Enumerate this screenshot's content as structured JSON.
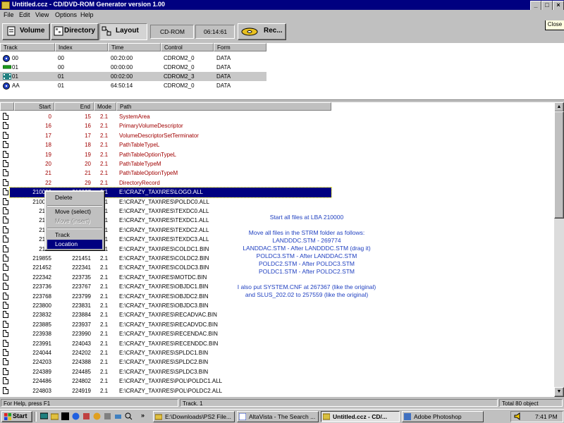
{
  "window": {
    "title": "Untitled.ccz - CD/DVD-ROM Generator version 1.00",
    "controls": [
      "_",
      "□",
      "×"
    ]
  },
  "tooltip": "Close",
  "menu": [
    "File",
    "Edit",
    "View",
    "Options",
    "Help"
  ],
  "toolbar": {
    "volume": "Volume",
    "directory": "Directory",
    "layout": "Layout",
    "device": "CD-ROM",
    "time": "06:14:61",
    "record": "Rec..."
  },
  "tracks": {
    "headers": [
      "Track",
      "Index",
      "Time",
      "Control",
      "Form"
    ],
    "rows": [
      {
        "track": "00",
        "index": "00",
        "time": "00:20:00",
        "control": "CDROM2_0",
        "form": "DATA",
        "icon": "disc-icon"
      },
      {
        "track": "01",
        "index": "00",
        "time": "00:00:00",
        "control": "CDROM2_0",
        "form": "DATA",
        "icon": "green-bar-icon"
      },
      {
        "track": "01",
        "index": "01",
        "time": "00:02:00",
        "control": "CDROM2_3",
        "form": "DATA",
        "icon": "film-icon",
        "selected": true
      },
      {
        "track": "AA",
        "index": "01",
        "time": "64:50:14",
        "control": "CDROM2_0",
        "form": "DATA",
        "icon": "disc-icon"
      }
    ]
  },
  "files": {
    "headers": [
      "Start",
      "End",
      "Mode",
      "Path"
    ],
    "rows": [
      {
        "start": "0",
        "end": "15",
        "mode": "2.1",
        "path": "SystemArea",
        "red": true
      },
      {
        "start": "16",
        "end": "16",
        "mode": "2.1",
        "path": "PrimaryVolumeDescriptor",
        "red": true
      },
      {
        "start": "17",
        "end": "17",
        "mode": "2.1",
        "path": "VolumeDescriptorSetTerminator",
        "red": true
      },
      {
        "start": "18",
        "end": "18",
        "mode": "2.1",
        "path": "PathTableTypeL",
        "red": true
      },
      {
        "start": "19",
        "end": "19",
        "mode": "2.1",
        "path": "PathTableOptionTypeL",
        "red": true
      },
      {
        "start": "20",
        "end": "20",
        "mode": "2.1",
        "path": "PathTableTypeM",
        "red": true
      },
      {
        "start": "21",
        "end": "21",
        "mode": "2.1",
        "path": "PathTableOptionTypeM",
        "red": true
      },
      {
        "start": "22",
        "end": "29",
        "mode": "2.1",
        "path": "DirectoryRecord",
        "red": true
      },
      {
        "start": "210000",
        "end": "210037",
        "mode": "2.1",
        "path": "E:\\CRAZY_TAXI\\RES\\LOGO.ALL",
        "selected": true
      },
      {
        "start": "210038",
        "end": "",
        "mode": "2.1",
        "path": "E:\\CRAZY_TAXI\\RES\\POLDC0.ALL"
      },
      {
        "start": "2131",
        "end": "",
        "mode": "2.1",
        "path": "E:\\CRAZY_TAXI\\RES\\TEXDC0.ALL"
      },
      {
        "start": "2145",
        "end": "",
        "mode": "2.1",
        "path": "E:\\CRAZY_TAXI\\RES\\TEXDC1.ALL"
      },
      {
        "start": "2157",
        "end": "",
        "mode": "2.1",
        "path": "E:\\CRAZY_TAXI\\RES\\TEXDC2.ALL"
      },
      {
        "start": "2170",
        "end": "",
        "mode": "2.1",
        "path": "E:\\CRAZY_TAXI\\RES\\TEXDC3.ALL"
      },
      {
        "start": "2184",
        "end": "",
        "mode": "2.1",
        "path": "E:\\CRAZY_TAXI\\RES\\COLDC1.BIN"
      },
      {
        "start": "219855",
        "end": "221451",
        "mode": "2.1",
        "path": "E:\\CRAZY_TAXI\\RES\\COLDC2.BIN"
      },
      {
        "start": "221452",
        "end": "222341",
        "mode": "2.1",
        "path": "E:\\CRAZY_TAXI\\RES\\COLDC3.BIN"
      },
      {
        "start": "222342",
        "end": "223735",
        "mode": "2.1",
        "path": "E:\\CRAZY_TAXI\\RES\\MOTDC.BIN"
      },
      {
        "start": "223736",
        "end": "223767",
        "mode": "2.1",
        "path": "E:\\CRAZY_TAXI\\RES\\OBJDC1.BIN"
      },
      {
        "start": "223768",
        "end": "223799",
        "mode": "2.1",
        "path": "E:\\CRAZY_TAXI\\RES\\OBJDC2.BIN"
      },
      {
        "start": "223800",
        "end": "223831",
        "mode": "2.1",
        "path": "E:\\CRAZY_TAXI\\RES\\OBJDC3.BIN"
      },
      {
        "start": "223832",
        "end": "223884",
        "mode": "2.1",
        "path": "E:\\CRAZY_TAXI\\RES\\RECADVAC.BIN"
      },
      {
        "start": "223885",
        "end": "223937",
        "mode": "2.1",
        "path": "E:\\CRAZY_TAXI\\RES\\RECADVDC.BIN"
      },
      {
        "start": "223938",
        "end": "223990",
        "mode": "2.1",
        "path": "E:\\CRAZY_TAXI\\RES\\RECENDAC.BIN"
      },
      {
        "start": "223991",
        "end": "224043",
        "mode": "2.1",
        "path": "E:\\CRAZY_TAXI\\RES\\RECENDDC.BIN"
      },
      {
        "start": "224044",
        "end": "224202",
        "mode": "2.1",
        "path": "E:\\CRAZY_TAXI\\RES\\SPLDC1.BIN"
      },
      {
        "start": "224203",
        "end": "224388",
        "mode": "2.1",
        "path": "E:\\CRAZY_TAXI\\RES\\SPLDC2.BIN"
      },
      {
        "start": "224389",
        "end": "224485",
        "mode": "2.1",
        "path": "E:\\CRAZY_TAXI\\RES\\SPLDC3.BIN"
      },
      {
        "start": "224486",
        "end": "224802",
        "mode": "2.1",
        "path": "E:\\CRAZY_TAXI\\RES\\POL\\POLDC1.ALL"
      },
      {
        "start": "224803",
        "end": "224919",
        "mode": "2.1",
        "path": "E:\\CRAZY_TAXI\\RES\\POL\\POLDC2.ALL"
      }
    ]
  },
  "context_menu": {
    "items": [
      {
        "label": "Delete",
        "disabled": false
      },
      {
        "label": "Move (select)",
        "disabled": false
      },
      {
        "label": "Move (insert)",
        "disabled": true
      },
      {
        "label": "Track",
        "disabled": false
      },
      {
        "label": "Location",
        "disabled": false,
        "highlighted": true
      }
    ]
  },
  "note": [
    "Start all files at LBA 210000",
    "",
    "Move all files in the STRM folder as follows:",
    "LANDDDC.STM - 269774",
    "LANDDAC.STM - After LANDDDC.STM (drag it)",
    "POLDC3.STM - After LANDDAC.STM",
    "POLDC2.STM - After POLDC3.STM",
    "POLDC1.STM - After POLDC2.STM",
    "",
    "I also put SYSTEM.CNF at 267367 (like the original)",
    "and SLUS_202.02 to 257559 (like the original)"
  ],
  "status": {
    "help": "For Help, press F1",
    "track": "Track. 1",
    "total": "Total 80 object"
  },
  "taskbar": {
    "start": "Start",
    "tasks": [
      {
        "label": "E:\\Downloads\\PS2 File...",
        "active": false
      },
      {
        "label": "AltaVista - The Search ...",
        "active": false
      },
      {
        "label": "Untitled.ccz - CD/...",
        "active": true
      },
      {
        "label": "Adobe Photoshop",
        "active": false
      }
    ],
    "clock": "7:41 PM",
    "quick_launch_chevron": "»"
  },
  "colors": {
    "titlebar": "#000080",
    "selection": "#000080",
    "system_entries": "#a00000",
    "note": "#2040c0"
  }
}
